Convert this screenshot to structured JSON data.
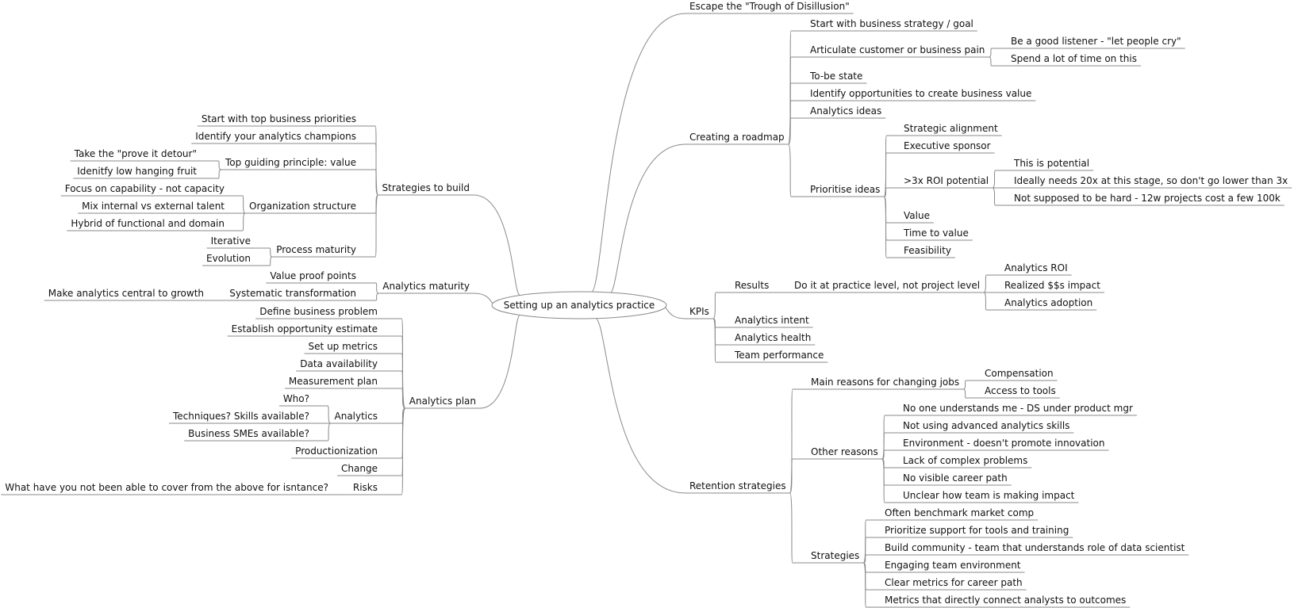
{
  "title": "Setting up an analytics practice",
  "root": {
    "label": "Setting up an analytics practice",
    "right": [
      {
        "label": "Escape the \"Trough of Disillusion\""
      },
      {
        "label": "Creating a roadmap",
        "children": [
          {
            "label": "Start with business strategy / goal"
          },
          {
            "label": "Articulate customer or business pain",
            "children": [
              {
                "label": "Be a good listener - \"let people cry\""
              },
              {
                "label": "Spend a lot of time on this"
              }
            ]
          },
          {
            "label": "To-be state"
          },
          {
            "label": "Identify opportunities to create business value"
          },
          {
            "label": "Analytics ideas"
          },
          {
            "label": "Prioritise ideas",
            "children": [
              {
                "label": "Strategic alignment"
              },
              {
                "label": "Executive sponsor"
              },
              {
                "label": ">3x ROI potential",
                "children": [
                  {
                    "label": "This is potential"
                  },
                  {
                    "label": "Ideally needs 20x at this stage, so don't go lower than 3x"
                  },
                  {
                    "label": "Not supposed to be hard - 12w projects cost a few 100k"
                  }
                ]
              },
              {
                "label": "Value"
              },
              {
                "label": "Time to value"
              },
              {
                "label": "Feasibility"
              }
            ]
          }
        ]
      },
      {
        "label": "KPIs",
        "children": [
          {
            "label": "Results",
            "children": [
              {
                "label": "Do it at practice level, not project level",
                "children": [
                  {
                    "label": "Analytics ROI"
                  },
                  {
                    "label": "Realized $$s impact"
                  },
                  {
                    "label": "Analytics adoption"
                  }
                ]
              }
            ]
          },
          {
            "label": "Analytics intent"
          },
          {
            "label": "Analytics health"
          },
          {
            "label": "Team performance"
          }
        ]
      },
      {
        "label": "Retention strategies",
        "children": [
          {
            "label": "Main reasons for changing jobs",
            "children": [
              {
                "label": "Compensation"
              },
              {
                "label": "Access to tools"
              }
            ]
          },
          {
            "label": "Other reasons",
            "children": [
              {
                "label": "No one understands me - DS under product mgr"
              },
              {
                "label": "Not using advanced analytics skills"
              },
              {
                "label": "Environment - doesn't promote innovation"
              },
              {
                "label": "Lack of complex problems"
              },
              {
                "label": "No visible career path"
              },
              {
                "label": "Unclear how team is making impact"
              }
            ]
          },
          {
            "label": "Strategies",
            "children": [
              {
                "label": "Often benchmark market comp"
              },
              {
                "label": "Prioritize support for tools and training"
              },
              {
                "label": "Build community - team that understands role of data scientist"
              },
              {
                "label": "Engaging team environment"
              },
              {
                "label": "Clear metrics for career path"
              },
              {
                "label": "Metrics that directly connect analysts to outcomes"
              }
            ]
          }
        ]
      }
    ],
    "left": [
      {
        "label": "Strategies to build",
        "children": [
          {
            "label": "Start with top business priorities"
          },
          {
            "label": "Identify your analytics champions"
          },
          {
            "label": "Top guiding principle: value",
            "children": [
              {
                "label": "Take the \"prove it detour\""
              },
              {
                "label": "Idenitfy low hanging fruit"
              }
            ]
          },
          {
            "label": "Organization structure",
            "children": [
              {
                "label": "Focus on capability - not capacity"
              },
              {
                "label": "Mix internal vs external talent"
              },
              {
                "label": "Hybrid of functional and domain"
              }
            ]
          },
          {
            "label": "Process maturity",
            "children": [
              {
                "label": "Iterative"
              },
              {
                "label": "Evolution"
              }
            ]
          }
        ]
      },
      {
        "label": "Analytics maturity",
        "children": [
          {
            "label": "Value proof points"
          },
          {
            "label": "Systematic transformation",
            "children": [
              {
                "label": "Make analytics central to growth"
              }
            ]
          }
        ]
      },
      {
        "label": "Analytics plan",
        "children": [
          {
            "label": "Define business problem"
          },
          {
            "label": "Establish opportunity estimate"
          },
          {
            "label": "Set up metrics"
          },
          {
            "label": "Data availability"
          },
          {
            "label": "Measurement plan"
          },
          {
            "label": "Analytics",
            "children": [
              {
                "label": "Who?"
              },
              {
                "label": "Techniques? Skills available?"
              },
              {
                "label": "Business SMEs available?"
              }
            ]
          },
          {
            "label": "Productionization"
          },
          {
            "label": "Change"
          },
          {
            "label": "Risks",
            "children": [
              {
                "label": "What have you not been able to cover from the above for isntance?"
              }
            ]
          }
        ]
      }
    ]
  },
  "colors": {
    "edge": "#8a8a8a",
    "text": "#111111",
    "background": "#ffffff"
  }
}
